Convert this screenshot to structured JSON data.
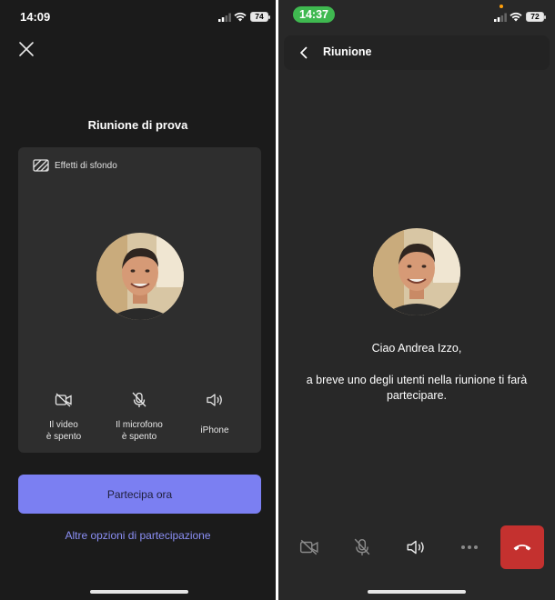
{
  "left": {
    "status": {
      "time": "14:09",
      "battery": "74"
    },
    "title": "Riunione di prova",
    "background_effects_label": "Effetti di sfondo",
    "controls": [
      {
        "label": "Il video\nè spento",
        "icon": "video-off-icon"
      },
      {
        "label": "Il microfono\nè spento",
        "icon": "mic-off-icon"
      },
      {
        "label": "iPhone",
        "icon": "speaker-icon"
      }
    ],
    "join_button_label": "Partecipa ora",
    "other_options_link": "Altre opzioni di partecipazione"
  },
  "right": {
    "status": {
      "time": "14:37",
      "battery": "72"
    },
    "header_title": "Riunione",
    "greeting": "Ciao Andrea Izzo,",
    "message": "a breve uno degli utenti nella riunione ti farà partecipare.",
    "call_controls": [
      "video-off-icon",
      "mic-off-icon",
      "speaker-icon",
      "more-icon",
      "hang-up-icon"
    ]
  },
  "colors": {
    "accent": "#7b7ff2",
    "link": "#8b8ff5",
    "hangup": "#c4312f",
    "time_pill": "#3fb950",
    "left_background": "#1b1b1b",
    "right_background": "#282828"
  }
}
